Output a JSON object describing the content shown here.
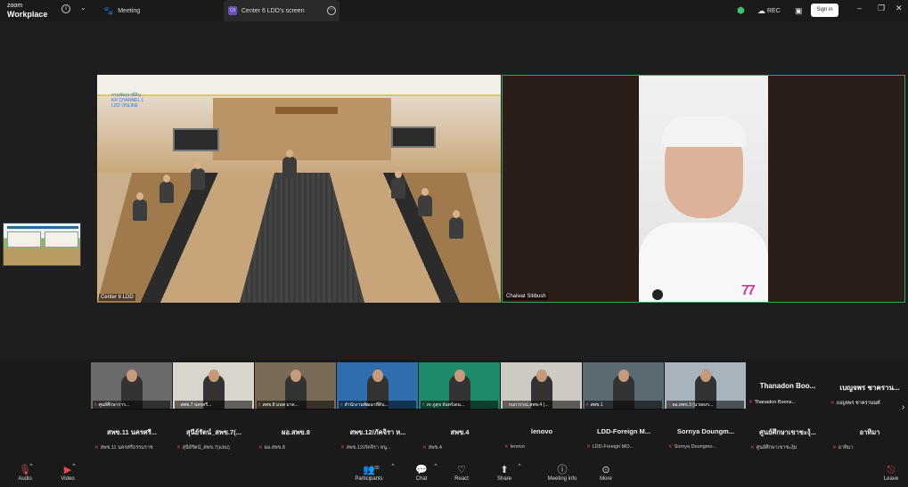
{
  "titlebar": {
    "logo_line1": "zoom",
    "logo_line2": "Workplace",
    "tab_meeting": "Meeting",
    "tab_screen": "Center 6 LDD's screen",
    "tab_screen_badge": "C6",
    "rec": "REC",
    "signin": "Sign in"
  },
  "stage": {
    "video1_label": "Center 6 LDD",
    "video1_overlay": "กรมพัฒนาที่ดิน\nKR CHANNEL 1\nLDD ONLINE",
    "video2_label": "Chaiwat Sitibush"
  },
  "gallery": [
    {
      "type": "video",
      "caption": "ศูนย์ศึกษาการ...",
      "name": "สพข.11 นครศรี...",
      "sub": "สพข.11 นครศรีธรรมราช"
    },
    {
      "type": "video",
      "caption": "สพข.7 นครศรี...",
      "name": "สุนีย์รัตน์_สพข.7(...",
      "sub": "สุนีย์รัตน์_สพข.7(แลม)"
    },
    {
      "type": "video",
      "caption": "สพข.8 มนพ มาด...",
      "name": "ผอ.สพข.8",
      "sub": "ผอ.สพข.8"
    },
    {
      "type": "video",
      "caption": "สำนักงานพัฒนาที่ดิน...",
      "name": "สพข.12/ภัคจิรา ห...",
      "sub": "สพข.12/ภัคจิรา หนู..."
    },
    {
      "type": "video",
      "caption": "เข ภูสุข จันทร์เดน...",
      "name": "สพข.4",
      "sub": "สพข.4"
    },
    {
      "type": "video",
      "caption": "กนกวรรณ สพข.4 (...",
      "name": "lenovo",
      "sub": "lenovo"
    },
    {
      "type": "video",
      "caption": "สพข.1",
      "name": "LDD-Foreign M...",
      "sub": "LDD-Foreign MO..."
    },
    {
      "type": "video",
      "caption": "ผอ.สพข.3 (นายยงร...",
      "name": "Sornya Doungm...",
      "sub": "Sornya Doungmo..."
    },
    {
      "type": "name",
      "bigname": "Thanadon Boo...",
      "caption": "Thanadon Boons...",
      "name": "ศูนย์ศึกษาเขาชะงุ้...",
      "sub": "ศูนย์ศึกษาเขาชะงุ้ม"
    },
    {
      "type": "name",
      "bigname": "เบญจพร ชาคราน...",
      "caption": "เบญจพร ชาครานนท์",
      "name": "อาทิมา",
      "sub": "อาทิมา"
    }
  ],
  "toolbar": {
    "audio": "Audio",
    "video": "Video",
    "participants": "Participants",
    "participants_count": "30",
    "chat": "Chat",
    "react": "React",
    "share": "Share",
    "meeting_info": "Meeting info",
    "more": "More",
    "leave": "Leave"
  }
}
